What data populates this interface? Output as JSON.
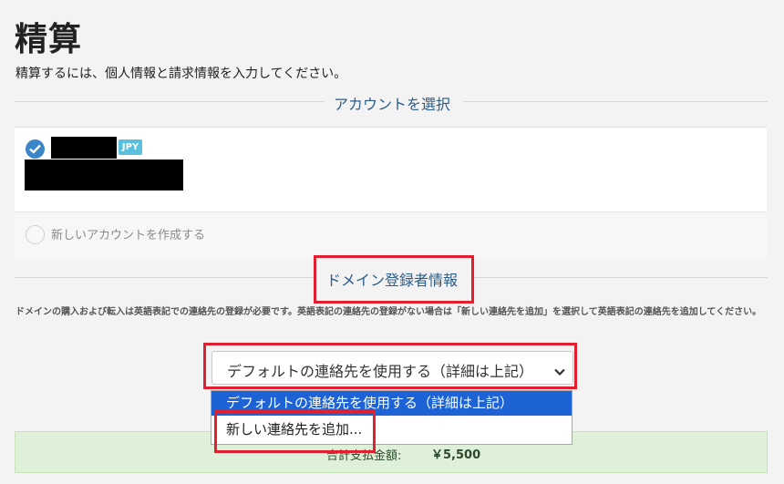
{
  "page": {
    "title": "精算",
    "subtitle": "精算するには、個人情報と請求情報を入力してください。"
  },
  "account_section": {
    "heading": "アカウントを選択",
    "currency_badge": "JPY",
    "new_account_label": "新しいアカウントを作成する"
  },
  "registrant_section": {
    "heading": "ドメイン登録者情報",
    "note": "ドメインの購入および転入は英語表記での連絡先の登録が必要です。英語表記の連絡先の登録がない場合は「新しい連絡先を追加」を選択して英語表記の連絡先を追加してください。",
    "contact_select": {
      "value": "デフォルトの連絡先を使用する（詳細は上記）",
      "options": [
        "デフォルトの連絡先を使用する（詳細は上記）",
        "新しい連絡先を追加..."
      ]
    }
  },
  "total": {
    "label": "合計支払金額:",
    "value": "￥5,500"
  },
  "colors": {
    "accent": "#2c5d8a",
    "highlight": "#e0202e",
    "selected_option": "#1e63d6",
    "success_bg": "#dff0d8"
  },
  "icons": [
    "check-icon",
    "chevron-down-icon"
  ]
}
